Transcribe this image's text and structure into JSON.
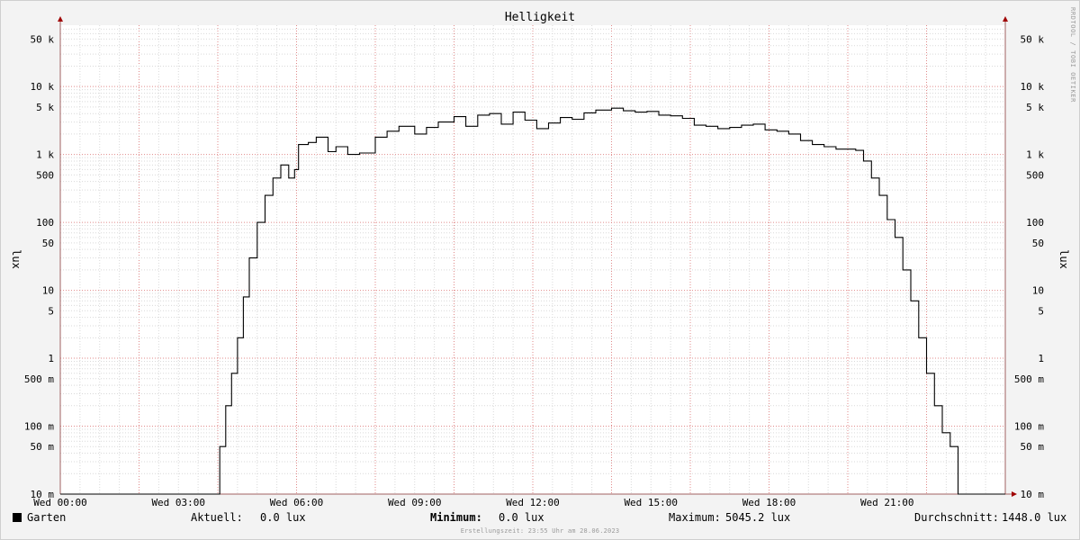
{
  "chart_data": {
    "type": "line",
    "title": "Helligkeit",
    "ylabel_left": "lux",
    "ylabel_right": "lux",
    "y_scale": "log",
    "ylim": [
      0.01,
      80000
    ],
    "xlim_hours": [
      0,
      24
    ],
    "grid": true,
    "y_ticks": [
      {
        "value": 0.01,
        "label": "10 m"
      },
      {
        "value": 0.05,
        "label": "50 m"
      },
      {
        "value": 0.1,
        "label": "100 m"
      },
      {
        "value": 0.5,
        "label": "500 m"
      },
      {
        "value": 1,
        "label": "1"
      },
      {
        "value": 5,
        "label": "5"
      },
      {
        "value": 10,
        "label": "10"
      },
      {
        "value": 50,
        "label": "50"
      },
      {
        "value": 100,
        "label": "100"
      },
      {
        "value": 500,
        "label": "500"
      },
      {
        "value": 1000,
        "label": "1 k"
      },
      {
        "value": 5000,
        "label": "5 k"
      },
      {
        "value": 10000,
        "label": "10 k"
      },
      {
        "value": 50000,
        "label": "50 k"
      }
    ],
    "x_ticks": [
      {
        "hour": 0,
        "label": "Wed 00:00"
      },
      {
        "hour": 3,
        "label": "Wed 03:00"
      },
      {
        "hour": 6,
        "label": "Wed 06:00"
      },
      {
        "hour": 9,
        "label": "Wed 09:00"
      },
      {
        "hour": 12,
        "label": "Wed 12:00"
      },
      {
        "hour": 15,
        "label": "Wed 15:00"
      },
      {
        "hour": 18,
        "label": "Wed 18:00"
      },
      {
        "hour": 21,
        "label": "Wed 21:00"
      }
    ],
    "series": [
      {
        "name": "Garten",
        "color": "#000000",
        "x_hours": [
          0.0,
          4.0,
          4.05,
          4.2,
          4.35,
          4.5,
          4.65,
          4.8,
          5.0,
          5.2,
          5.4,
          5.6,
          5.8,
          5.95,
          6.05,
          6.3,
          6.5,
          6.8,
          7.0,
          7.3,
          7.6,
          8.0,
          8.3,
          8.6,
          9.0,
          9.3,
          9.6,
          10.0,
          10.3,
          10.6,
          10.9,
          11.2,
          11.5,
          11.8,
          12.1,
          12.4,
          12.7,
          13.0,
          13.3,
          13.6,
          14.0,
          14.3,
          14.6,
          14.9,
          15.2,
          15.5,
          15.8,
          16.1,
          16.4,
          16.7,
          17.0,
          17.3,
          17.6,
          17.9,
          18.2,
          18.5,
          18.8,
          19.1,
          19.4,
          19.7,
          20.0,
          20.2,
          20.4,
          20.6,
          20.8,
          21.0,
          21.2,
          21.4,
          21.6,
          21.8,
          22.0,
          22.2,
          22.4,
          22.6,
          22.8,
          23.0,
          23.1,
          23.2,
          24.0
        ],
        "y_values": [
          0.01,
          0.01,
          0.05,
          0.2,
          0.6,
          2,
          8,
          30,
          100,
          250,
          450,
          700,
          450,
          600,
          1400,
          1500,
          1800,
          1100,
          1300,
          1000,
          1050,
          1800,
          2200,
          2600,
          2000,
          2500,
          3000,
          3600,
          2600,
          3800,
          4000,
          2800,
          4200,
          3200,
          2400,
          2900,
          3500,
          3300,
          4100,
          4500,
          4800,
          4400,
          4200,
          4300,
          3800,
          3700,
          3400,
          2700,
          2600,
          2400,
          2500,
          2700,
          2800,
          2300,
          2200,
          2000,
          1600,
          1400,
          1300,
          1200,
          1200,
          1150,
          800,
          450,
          250,
          110,
          60,
          20,
          7,
          2,
          0.6,
          0.2,
          0.08,
          0.05,
          0.01,
          0.01,
          0.01,
          0.01,
          0.01
        ]
      }
    ]
  },
  "legend": {
    "series_label": "Garten",
    "current_label": "Aktuell:",
    "current_value": "0.0 lux",
    "min_label": "Minimum:",
    "min_value": "0.0 lux",
    "max_label": "Maximum:",
    "max_value": "5045.2 lux",
    "avg_label": "Durchschnitt:",
    "avg_value": "1448.0 lux"
  },
  "footer": "Erstellungszeit: 23:55 Uhr am 28.06.2023",
  "side_credit": "RRDTOOL / TOBI OETIKER"
}
